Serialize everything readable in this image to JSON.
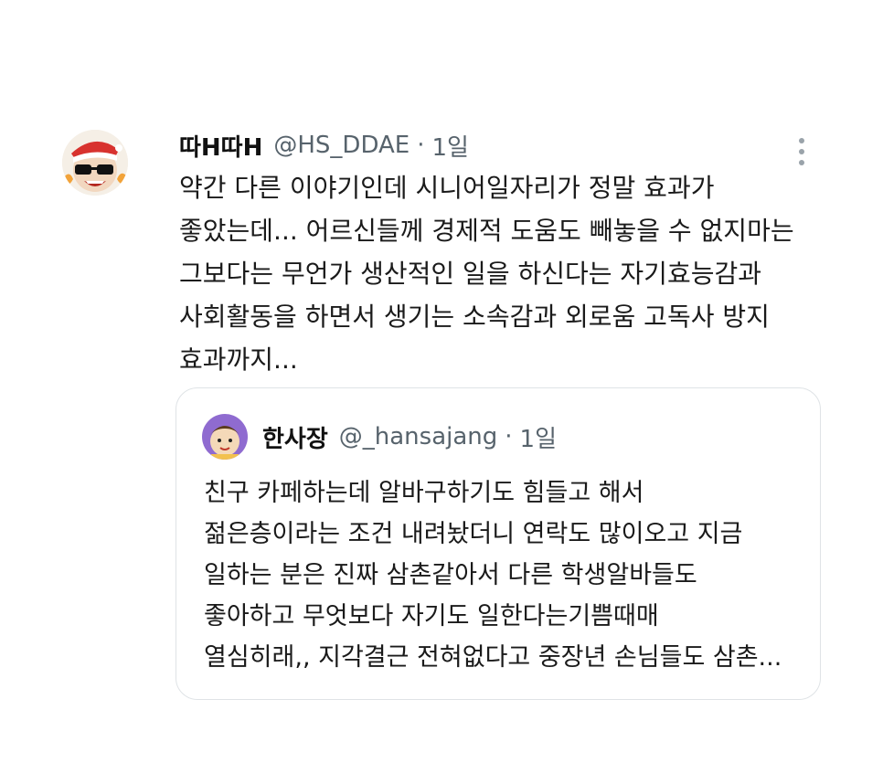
{
  "tweet": {
    "display_name": "따H따H",
    "handle": "@HS_DDAE",
    "separator": "·",
    "time": "1일",
    "avatar_icon": "cartoon-santa-sunglasses-avatar",
    "more_icon": "more-vertical-icon",
    "text_lines": [
      "약간 다른 이야기인데 시니어일자리가 정말 효과가",
      "좋았는데... 어르신들께 경제적 도움도 빼놓을 수 없지마는",
      "그보다는 무언가 생산적인 일을 하신다는 자기효능감과",
      "사회활동을 하면서 생기는 소속감과 외로움 고독사 방지",
      "효과까지..."
    ]
  },
  "quoted_tweet": {
    "display_name": "한사장",
    "handle": "@_hansajang",
    "separator": "·",
    "time": "1일",
    "avatar_icon": "cartoon-avatar-purple",
    "text_lines": [
      "친구 카페하는데 알바구하기도 힘들고 해서",
      "젊은층이라는 조건 내려놨더니 연락도 많이오고 지금",
      "일하는 분은 진짜 삼촌같아서 다른 학생알바들도",
      "좋아하고 무엇보다 자기도 일한다는기쁨때매",
      "열심히래,, 지각결근 전혀없다고 중장년 손님들도 삼촌..."
    ]
  },
  "colors": {
    "text": "#1a1a1a",
    "secondary": "#57636c",
    "border": "#dfe3e6",
    "background": "#ffffff"
  }
}
